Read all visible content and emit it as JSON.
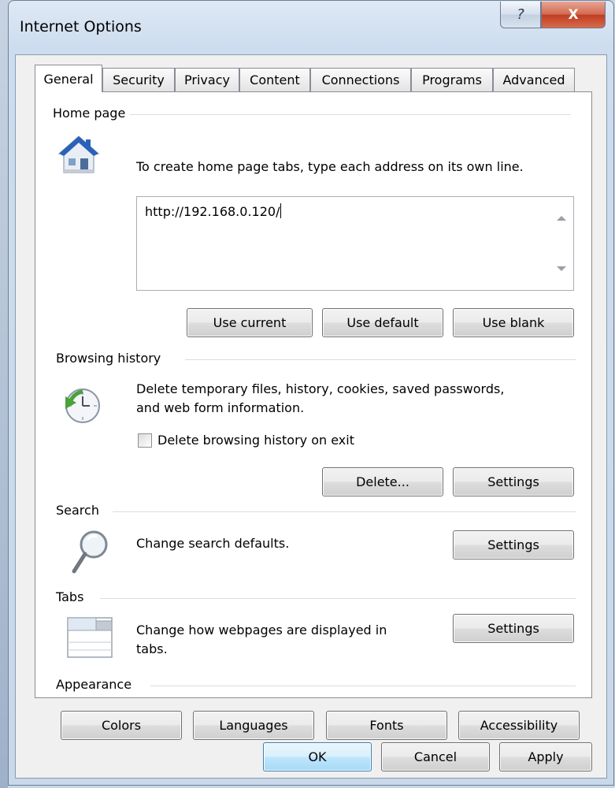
{
  "window": {
    "title": "Internet Options",
    "help_glyph": "?",
    "close_glyph": "X"
  },
  "tabs": [
    {
      "label": "General",
      "active": true
    },
    {
      "label": "Security",
      "active": false
    },
    {
      "label": "Privacy",
      "active": false
    },
    {
      "label": "Content",
      "active": false
    },
    {
      "label": "Connections",
      "active": false
    },
    {
      "label": "Programs",
      "active": false
    },
    {
      "label": "Advanced",
      "active": false
    }
  ],
  "home_page": {
    "label": "Home page",
    "icon": "house-icon",
    "description": "To create home page tabs, type each address on its own line.",
    "value": "http://192.168.0.120/",
    "buttons": {
      "use_current": "Use current",
      "use_default": "Use default",
      "use_blank": "Use blank"
    }
  },
  "browsing_history": {
    "label": "Browsing history",
    "icon": "history-clock-icon",
    "description_line1": "Delete temporary files, history, cookies, saved passwords,",
    "description_line2": "and web form information.",
    "checkbox_label": "Delete browsing history on exit",
    "checkbox_checked": false,
    "buttons": {
      "delete": "Delete...",
      "settings": "Settings"
    }
  },
  "search": {
    "label": "Search",
    "icon": "magnifier-icon",
    "description": "Change search defaults.",
    "settings": "Settings"
  },
  "tabs_section": {
    "label": "Tabs",
    "icon": "tabs-window-icon",
    "description_line1": "Change how webpages are displayed in",
    "description_line2": "tabs.",
    "settings": "Settings"
  },
  "appearance": {
    "label": "Appearance",
    "buttons": {
      "colors": "Colors",
      "languages": "Languages",
      "fonts": "Fonts",
      "accessibility": "Accessibility"
    }
  },
  "footer": {
    "ok": "OK",
    "cancel": "Cancel",
    "apply": "Apply"
  },
  "colors": {
    "close_button": "#c84a2f",
    "default_button_border": "#3c7fb1",
    "window_frame": "#cddcee"
  }
}
